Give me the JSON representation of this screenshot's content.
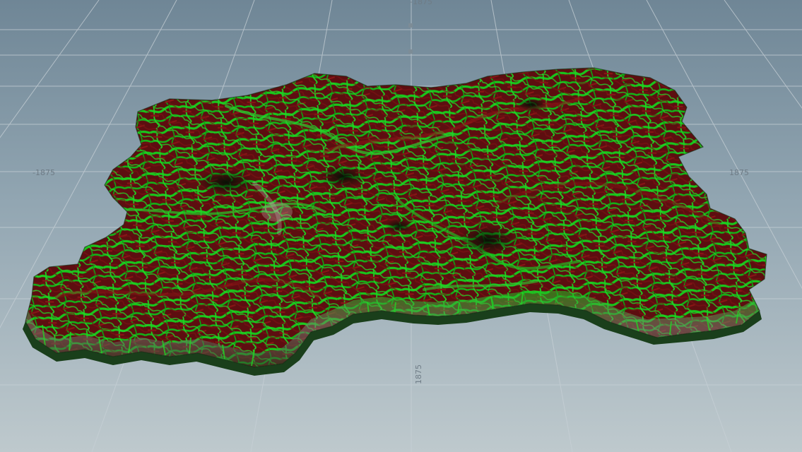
{
  "viewport": {
    "grid_labels": {
      "center_bottom": "1875",
      "left": "-1875",
      "right": "1875",
      "top": "-1875"
    },
    "colors": {
      "background_top": "#6f8696",
      "background_bottom": "#bcc7cb",
      "grid_line": "#c9d2d8",
      "terrain_green": "#17c41a",
      "terrain_red": "#6e0f10",
      "terrain_dark": "#0b2a0c",
      "terrain_light": "#9e9a92"
    }
  }
}
